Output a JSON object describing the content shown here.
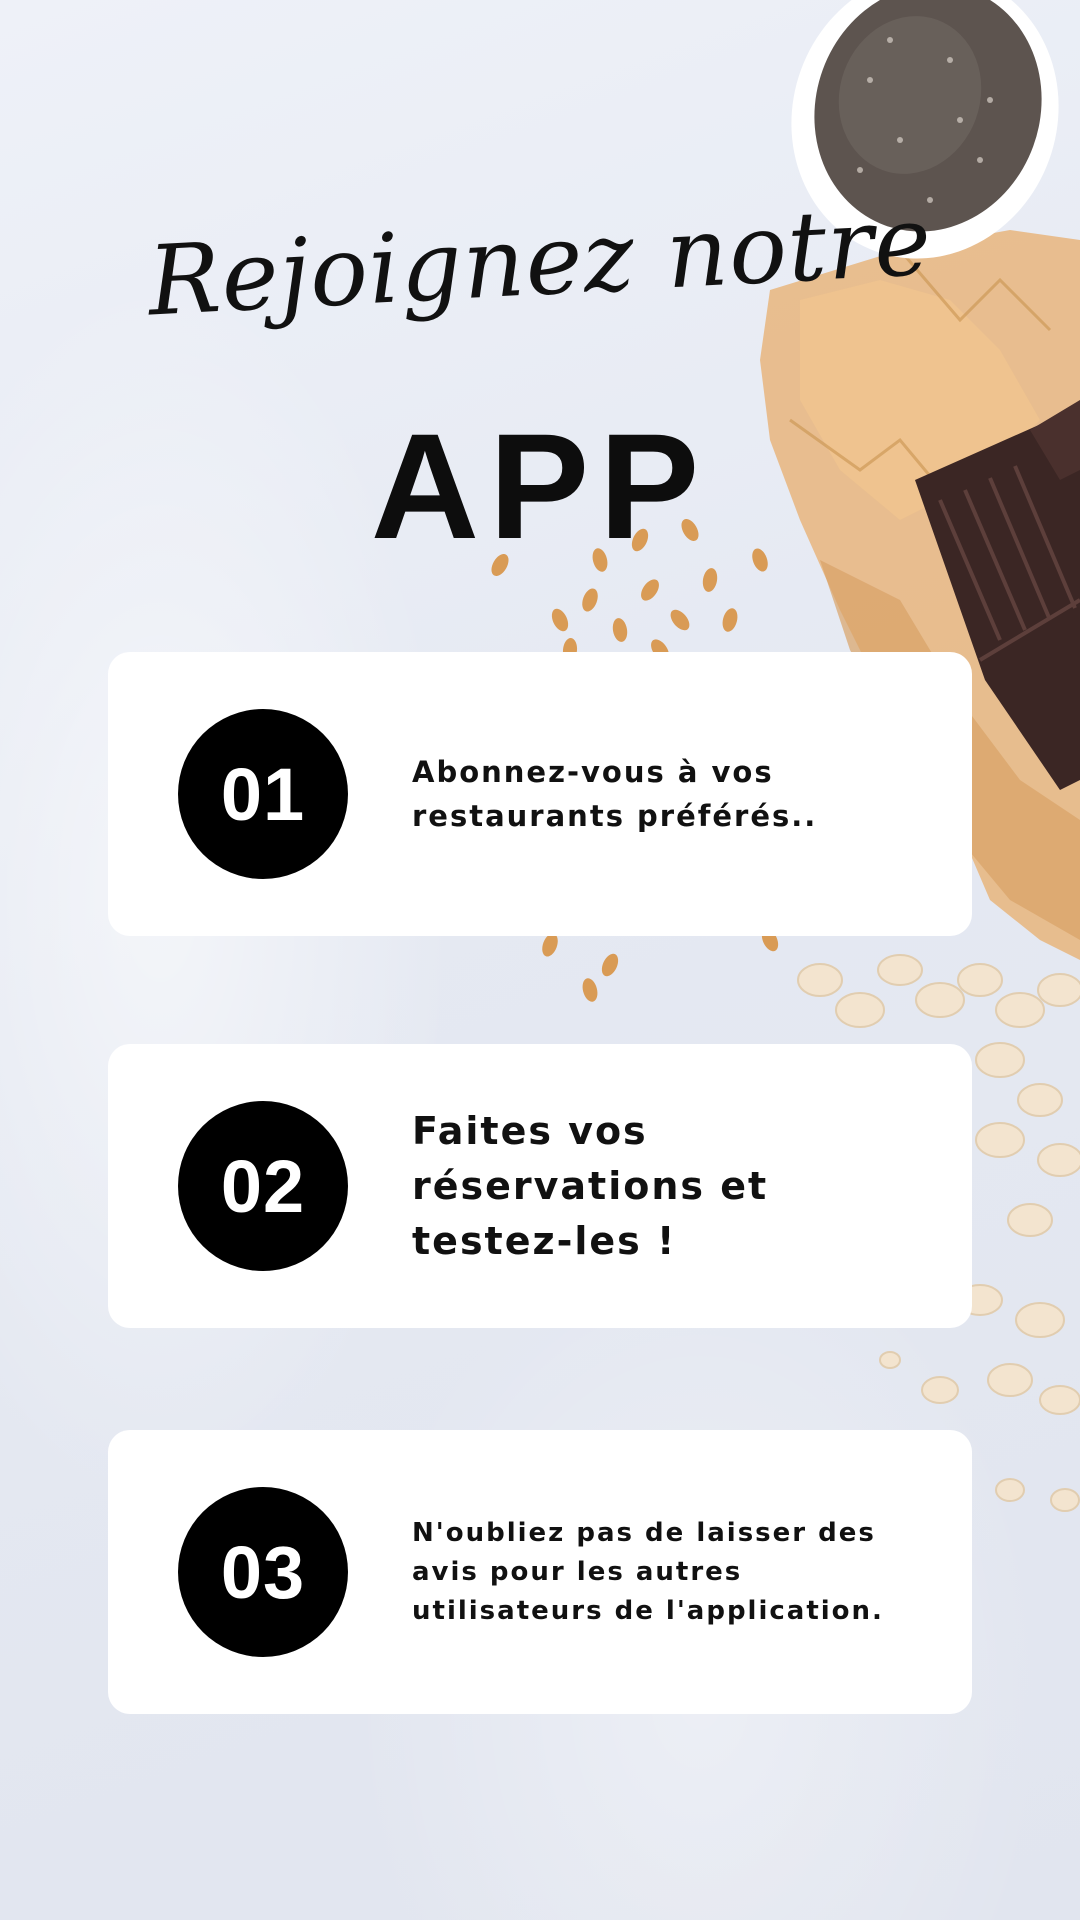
{
  "header": {
    "script_title": "Rejoignez notre",
    "main_title": "APP"
  },
  "steps": [
    {
      "number": "01",
      "text": "Abonnez-vous à vos restaurants préférés.."
    },
    {
      "number": "02",
      "text": "Faites vos réservations et testez-les !"
    },
    {
      "number": "03",
      "text": "N'oubliez pas de laisser des avis pour les autres utilisateurs de l'application."
    }
  ],
  "colors": {
    "background": "#e7ebf4",
    "card": "#ffffff",
    "badge": "#000000",
    "text": "#111111"
  },
  "decor_icons": [
    "chia-seed-bowl-icon",
    "parchment-paper-icon",
    "chocolate-bar-icon",
    "flax-seeds-icon",
    "oat-flakes-icon"
  ]
}
